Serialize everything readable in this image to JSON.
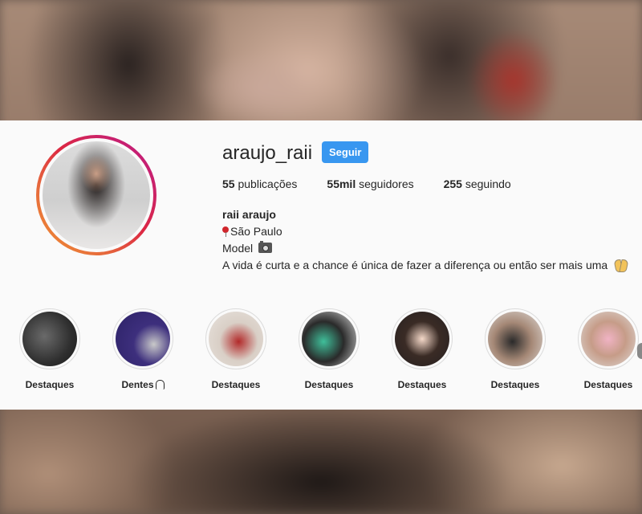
{
  "profile": {
    "username": "araujo_raii",
    "follow_label": "Seguir",
    "stats": {
      "posts_count": "55",
      "posts_label": "publicações",
      "followers_count": "55mil",
      "followers_label": "seguidores",
      "following_count": "255",
      "following_label": "seguindo"
    },
    "bio": {
      "name": "raii araujo",
      "location": "São Paulo",
      "occupation": "Model",
      "text": "A vida é curta e a chance é única de fazer a diferença ou então ser mais uma"
    }
  },
  "highlights": [
    {
      "label": "Destaques",
      "icon": null
    },
    {
      "label": "Dentes",
      "icon": "tooth-icon"
    },
    {
      "label": "Destaques",
      "icon": null
    },
    {
      "label": "Destaques",
      "icon": null
    },
    {
      "label": "Destaques",
      "icon": null
    },
    {
      "label": "Destaques",
      "icon": null
    },
    {
      "label": "Destaques",
      "icon": null
    }
  ],
  "colors": {
    "follow_button": "#3897f0",
    "story_ring_start": "#f09433",
    "story_ring_end": "#bc1888",
    "text": "#262626",
    "panel": "#fafafa"
  }
}
